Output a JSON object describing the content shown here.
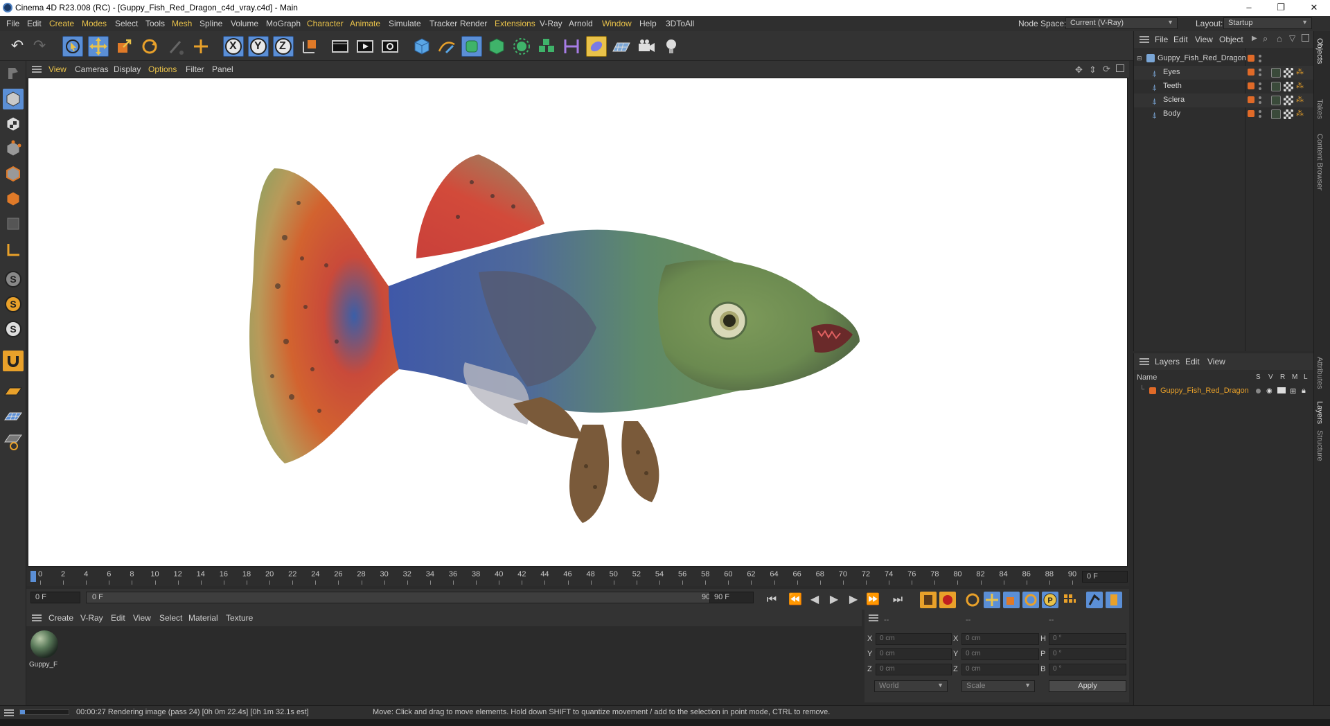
{
  "window": {
    "title": "Cinema 4D R23.008 (RC) - [Guppy_Fish_Red_Dragon_c4d_vray.c4d] - Main",
    "minimize": "–",
    "maximize": "❐",
    "close": "✕"
  },
  "menu": {
    "items": [
      "File",
      "Edit",
      "Create",
      "Modes",
      "Select",
      "Tools",
      "Mesh",
      "Spline",
      "Volume",
      "MoGraph",
      "Character",
      "Animate",
      "Simulate",
      "Tracker",
      "Render",
      "Extensions",
      "V-Ray",
      "Arnold",
      "Window",
      "Help",
      "3DToAll"
    ],
    "node_space_label": "Node Space:",
    "node_space_value": "Current (V-Ray)",
    "layout_label": "Layout:",
    "layout_value": "Startup"
  },
  "toolbar": {
    "axis_x": "X",
    "axis_y": "Y",
    "axis_z": "Z"
  },
  "viewport": {
    "menu": [
      "View",
      "Cameras",
      "Display",
      "Options",
      "Filter",
      "Panel"
    ]
  },
  "timeline": {
    "ticks": [
      "0",
      "2",
      "4",
      "6",
      "8",
      "10",
      "12",
      "14",
      "16",
      "18",
      "20",
      "22",
      "24",
      "26",
      "28",
      "30",
      "32",
      "34",
      "36",
      "38",
      "40",
      "42",
      "44",
      "46",
      "48",
      "50",
      "52",
      "54",
      "56",
      "58",
      "60",
      "62",
      "64",
      "66",
      "68",
      "70",
      "72",
      "74",
      "76",
      "78",
      "80",
      "82",
      "84",
      "86",
      "88",
      "90"
    ],
    "current_frame": "0 F",
    "start_frame": "0 F",
    "range_start": "0 F",
    "range_end": "90 F",
    "end_frame": "90 F"
  },
  "material_manager": {
    "menu": [
      "Create",
      "V-Ray",
      "Edit",
      "View",
      "Select",
      "Material",
      "Texture"
    ],
    "materials": [
      {
        "name": "Guppy_F"
      }
    ]
  },
  "coordinates": {
    "header": [
      "--",
      "--",
      "--"
    ],
    "rows": [
      {
        "a_label": "X",
        "a_val": "0 cm",
        "b_label": "X",
        "b_val": "0 cm",
        "c_label": "H",
        "c_val": "0 °"
      },
      {
        "a_label": "Y",
        "a_val": "0 cm",
        "b_label": "Y",
        "b_val": "0 cm",
        "c_label": "P",
        "c_val": "0 °"
      },
      {
        "a_label": "Z",
        "a_val": "0 cm",
        "b_label": "Z",
        "b_val": "0 cm",
        "c_label": "B",
        "c_val": "0 °"
      }
    ],
    "space": "World",
    "mode": "Scale",
    "apply": "Apply"
  },
  "object_manager": {
    "menu": [
      "File",
      "Edit",
      "View",
      "Object"
    ],
    "root": "Guppy_Fish_Red_Dragon",
    "children": [
      "Eyes",
      "Teeth",
      "Sclera",
      "Body"
    ]
  },
  "layer_manager": {
    "menu": [
      "Layers",
      "Edit",
      "View"
    ],
    "name_header": "Name",
    "flags": [
      "S",
      "V",
      "R",
      "M",
      "L"
    ],
    "layers": [
      {
        "name": "Guppy_Fish_Red_Dragon"
      }
    ]
  },
  "side_tabs": [
    "Objects",
    "Takes",
    "Content Browser",
    "Attributes",
    "Layers",
    "Structure"
  ],
  "status": {
    "render_text": "00:00:27 Rendering image (pass 24) [0h  0m 22.4s] [0h  1m 32.1s est]",
    "hint": "Move: Click and drag to move elements. Hold down SHIFT to quantize movement / add to the selection in point mode, CTRL to remove.",
    "render_progress": 0.1
  },
  "colors": {
    "accent": "#e9c24a",
    "tool_blue": "#5b8fd6",
    "swatch_orange": "#e06a28"
  }
}
